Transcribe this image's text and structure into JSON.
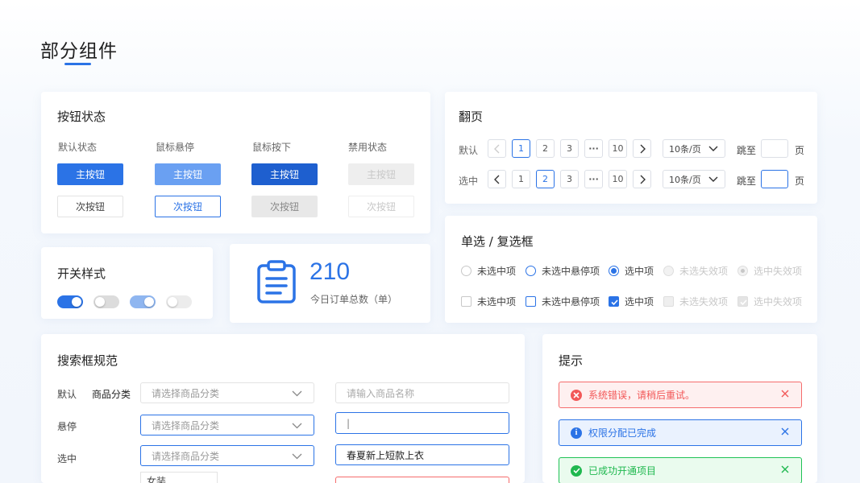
{
  "page": {
    "title": "部分组件"
  },
  "buttons_card": {
    "title": "按钮状态",
    "states": [
      "默认状态",
      "鼠标悬停",
      "鼠标按下",
      "禁用状态"
    ],
    "primary_label": "主按钮",
    "secondary_label": "次按钮"
  },
  "switch_card": {
    "title": "开关样式"
  },
  "stat_card": {
    "value": "210",
    "label": "今日订单总数（单）",
    "icon": "clipboard-icon"
  },
  "pager_card": {
    "title": "翻页",
    "rows": [
      {
        "label": "默认",
        "pages": [
          "1",
          "2",
          "3",
          "···",
          "10"
        ],
        "current": "1",
        "page_size": "10条/页",
        "jump_label": "跳至",
        "page_unit": "页"
      },
      {
        "label": "选中",
        "pages": [
          "1",
          "2",
          "3",
          "···",
          "10"
        ],
        "current": "2",
        "page_size": "10条/页",
        "jump_label": "跳至",
        "page_unit": "页"
      }
    ]
  },
  "choice_card": {
    "title": "单选 / 复选框",
    "options": [
      "未选中项",
      "未选中悬停项",
      "选中项",
      "未选失效项",
      "选中失效项"
    ]
  },
  "search_card": {
    "title": "搜索框规范",
    "row_labels": [
      "默认",
      "悬停",
      "选中"
    ],
    "field_label": "商品分类",
    "select_placeholder": "请选择商品分类",
    "input_placeholder": "请输入商品名称",
    "hover_input_value": "|",
    "filled_input_value": "春夏新上短款上衣",
    "dropdown_first_option": "女装"
  },
  "alert_card": {
    "title": "提示",
    "alerts": [
      {
        "type": "error",
        "text": "系统错误，请稍后重试。"
      },
      {
        "type": "info",
        "text": "权限分配已完成"
      },
      {
        "type": "success",
        "text": "已成功开通项目"
      }
    ]
  },
  "colors": {
    "primary": "#2b73e6",
    "error": "#f56c6c",
    "success": "#1fc255"
  }
}
